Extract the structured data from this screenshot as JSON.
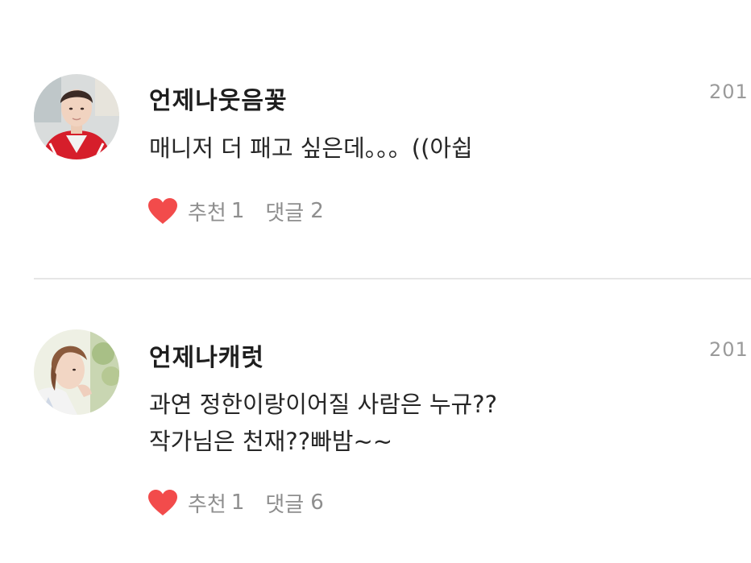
{
  "comments": [
    {
      "username": "언제나웃음꽃",
      "date": "201",
      "body_lines": [
        "매니저 더 패고 싶은데。。。((아쉽"
      ],
      "like_label": "추천",
      "like_count": "1",
      "reply_label": "댓글",
      "reply_count": "2"
    },
    {
      "username": "언제나캐럿",
      "date": "201",
      "body_lines": [
        "과연 정한이랑이어질 사람은 누규??",
        "작가님은 천재??빠밤~~"
      ],
      "like_label": "추천",
      "like_count": "1",
      "reply_label": "댓글",
      "reply_count": "6"
    }
  ],
  "colors": {
    "heart": "#f24b4b",
    "meta_text": "#8e8e8e",
    "divider": "#e6e6e6"
  },
  "icons": {
    "like": "heart-icon"
  }
}
